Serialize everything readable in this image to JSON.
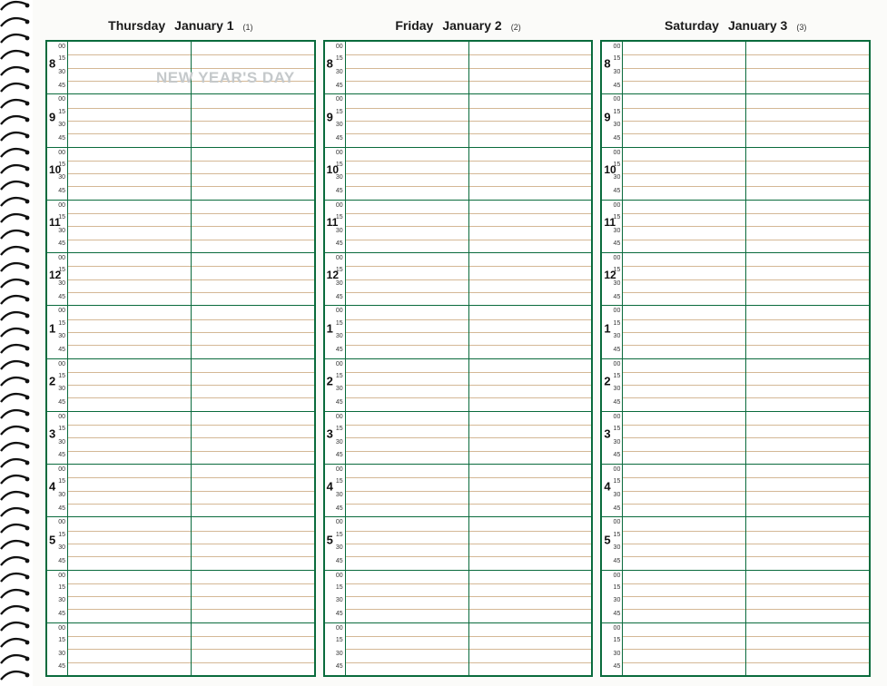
{
  "days": [
    {
      "weekday": "Thursday",
      "date": "January 1",
      "ord": "(1)",
      "holiday": "NEW YEAR'S DAY"
    },
    {
      "weekday": "Friday",
      "date": "January 2",
      "ord": "(2)",
      "holiday": ""
    },
    {
      "weekday": "Saturday",
      "date": "January 3",
      "ord": "(3)",
      "holiday": ""
    }
  ],
  "hours": [
    "8",
    "9",
    "10",
    "11",
    "12",
    "1",
    "2",
    "3",
    "4",
    "5",
    "",
    ""
  ],
  "minutes": [
    "00",
    "15",
    "30",
    "45"
  ]
}
